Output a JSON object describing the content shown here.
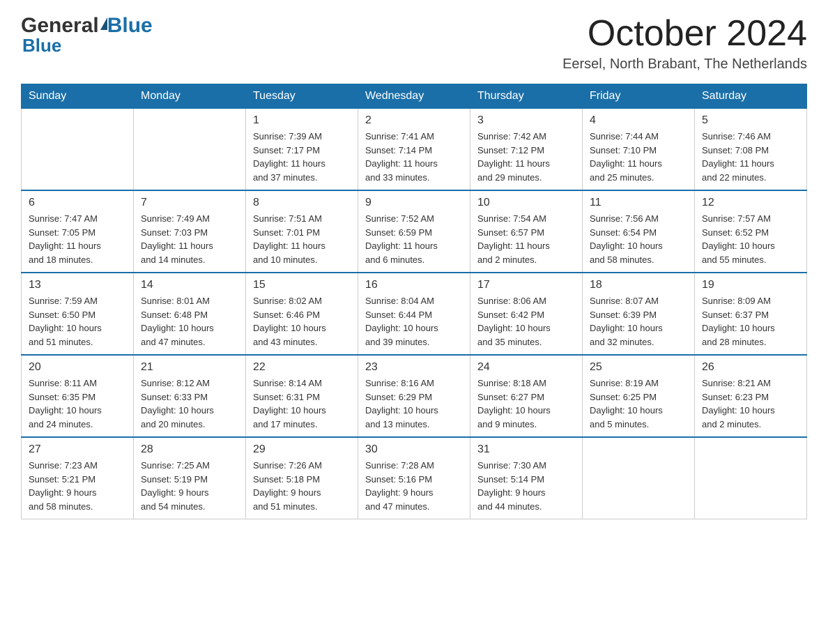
{
  "logo": {
    "general": "General",
    "blue": "Blue"
  },
  "header": {
    "title": "October 2024",
    "location": "Eersel, North Brabant, The Netherlands"
  },
  "days_of_week": [
    "Sunday",
    "Monday",
    "Tuesday",
    "Wednesday",
    "Thursday",
    "Friday",
    "Saturday"
  ],
  "weeks": [
    [
      {
        "day": "",
        "info": ""
      },
      {
        "day": "",
        "info": ""
      },
      {
        "day": "1",
        "info": "Sunrise: 7:39 AM\nSunset: 7:17 PM\nDaylight: 11 hours\nand 37 minutes."
      },
      {
        "day": "2",
        "info": "Sunrise: 7:41 AM\nSunset: 7:14 PM\nDaylight: 11 hours\nand 33 minutes."
      },
      {
        "day": "3",
        "info": "Sunrise: 7:42 AM\nSunset: 7:12 PM\nDaylight: 11 hours\nand 29 minutes."
      },
      {
        "day": "4",
        "info": "Sunrise: 7:44 AM\nSunset: 7:10 PM\nDaylight: 11 hours\nand 25 minutes."
      },
      {
        "day": "5",
        "info": "Sunrise: 7:46 AM\nSunset: 7:08 PM\nDaylight: 11 hours\nand 22 minutes."
      }
    ],
    [
      {
        "day": "6",
        "info": "Sunrise: 7:47 AM\nSunset: 7:05 PM\nDaylight: 11 hours\nand 18 minutes."
      },
      {
        "day": "7",
        "info": "Sunrise: 7:49 AM\nSunset: 7:03 PM\nDaylight: 11 hours\nand 14 minutes."
      },
      {
        "day": "8",
        "info": "Sunrise: 7:51 AM\nSunset: 7:01 PM\nDaylight: 11 hours\nand 10 minutes."
      },
      {
        "day": "9",
        "info": "Sunrise: 7:52 AM\nSunset: 6:59 PM\nDaylight: 11 hours\nand 6 minutes."
      },
      {
        "day": "10",
        "info": "Sunrise: 7:54 AM\nSunset: 6:57 PM\nDaylight: 11 hours\nand 2 minutes."
      },
      {
        "day": "11",
        "info": "Sunrise: 7:56 AM\nSunset: 6:54 PM\nDaylight: 10 hours\nand 58 minutes."
      },
      {
        "day": "12",
        "info": "Sunrise: 7:57 AM\nSunset: 6:52 PM\nDaylight: 10 hours\nand 55 minutes."
      }
    ],
    [
      {
        "day": "13",
        "info": "Sunrise: 7:59 AM\nSunset: 6:50 PM\nDaylight: 10 hours\nand 51 minutes."
      },
      {
        "day": "14",
        "info": "Sunrise: 8:01 AM\nSunset: 6:48 PM\nDaylight: 10 hours\nand 47 minutes."
      },
      {
        "day": "15",
        "info": "Sunrise: 8:02 AM\nSunset: 6:46 PM\nDaylight: 10 hours\nand 43 minutes."
      },
      {
        "day": "16",
        "info": "Sunrise: 8:04 AM\nSunset: 6:44 PM\nDaylight: 10 hours\nand 39 minutes."
      },
      {
        "day": "17",
        "info": "Sunrise: 8:06 AM\nSunset: 6:42 PM\nDaylight: 10 hours\nand 35 minutes."
      },
      {
        "day": "18",
        "info": "Sunrise: 8:07 AM\nSunset: 6:39 PM\nDaylight: 10 hours\nand 32 minutes."
      },
      {
        "day": "19",
        "info": "Sunrise: 8:09 AM\nSunset: 6:37 PM\nDaylight: 10 hours\nand 28 minutes."
      }
    ],
    [
      {
        "day": "20",
        "info": "Sunrise: 8:11 AM\nSunset: 6:35 PM\nDaylight: 10 hours\nand 24 minutes."
      },
      {
        "day": "21",
        "info": "Sunrise: 8:12 AM\nSunset: 6:33 PM\nDaylight: 10 hours\nand 20 minutes."
      },
      {
        "day": "22",
        "info": "Sunrise: 8:14 AM\nSunset: 6:31 PM\nDaylight: 10 hours\nand 17 minutes."
      },
      {
        "day": "23",
        "info": "Sunrise: 8:16 AM\nSunset: 6:29 PM\nDaylight: 10 hours\nand 13 minutes."
      },
      {
        "day": "24",
        "info": "Sunrise: 8:18 AM\nSunset: 6:27 PM\nDaylight: 10 hours\nand 9 minutes."
      },
      {
        "day": "25",
        "info": "Sunrise: 8:19 AM\nSunset: 6:25 PM\nDaylight: 10 hours\nand 5 minutes."
      },
      {
        "day": "26",
        "info": "Sunrise: 8:21 AM\nSunset: 6:23 PM\nDaylight: 10 hours\nand 2 minutes."
      }
    ],
    [
      {
        "day": "27",
        "info": "Sunrise: 7:23 AM\nSunset: 5:21 PM\nDaylight: 9 hours\nand 58 minutes."
      },
      {
        "day": "28",
        "info": "Sunrise: 7:25 AM\nSunset: 5:19 PM\nDaylight: 9 hours\nand 54 minutes."
      },
      {
        "day": "29",
        "info": "Sunrise: 7:26 AM\nSunset: 5:18 PM\nDaylight: 9 hours\nand 51 minutes."
      },
      {
        "day": "30",
        "info": "Sunrise: 7:28 AM\nSunset: 5:16 PM\nDaylight: 9 hours\nand 47 minutes."
      },
      {
        "day": "31",
        "info": "Sunrise: 7:30 AM\nSunset: 5:14 PM\nDaylight: 9 hours\nand 44 minutes."
      },
      {
        "day": "",
        "info": ""
      },
      {
        "day": "",
        "info": ""
      }
    ]
  ]
}
